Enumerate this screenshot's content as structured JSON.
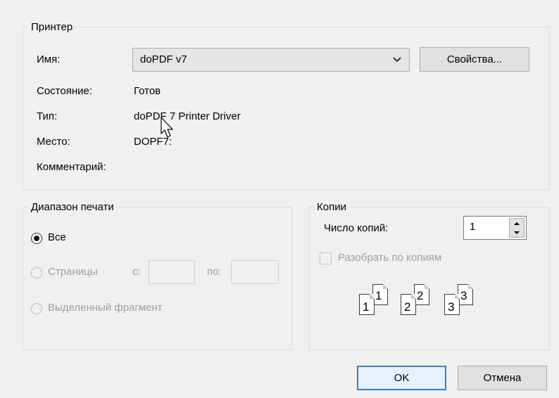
{
  "printer": {
    "group_label": "Принтер",
    "name_label": "Имя:",
    "name_value": "doPDF v7",
    "properties_button": "Свойства...",
    "status_label": "Состояние:",
    "status_value": "Готов",
    "type_label": "Тип:",
    "type_value": "doPDF 7 Printer Driver",
    "location_label": "Место:",
    "location_value": "DOPF7:",
    "comment_label": "Комментарий:"
  },
  "range": {
    "group_label": "Диапазон печати",
    "all_label": "Все",
    "pages_label": "Страницы",
    "from_label": "с:",
    "to_label": "по:",
    "selection_label": "Выделенный фрагмент",
    "selected": "all"
  },
  "copies": {
    "group_label": "Копии",
    "count_label": "Число копий:",
    "count_value": "1",
    "collate_label": "Разобрать по копиям",
    "collate_checked": false,
    "collate_icon_numbers": [
      "1",
      "1",
      "2",
      "2",
      "3",
      "3"
    ]
  },
  "buttons": {
    "ok": "OK",
    "cancel": "Отмена"
  },
  "icons": [
    "chevron-down-icon",
    "spin-up-icon",
    "spin-down-icon",
    "mouse-cursor-icon",
    "collate-pages-icon"
  ]
}
